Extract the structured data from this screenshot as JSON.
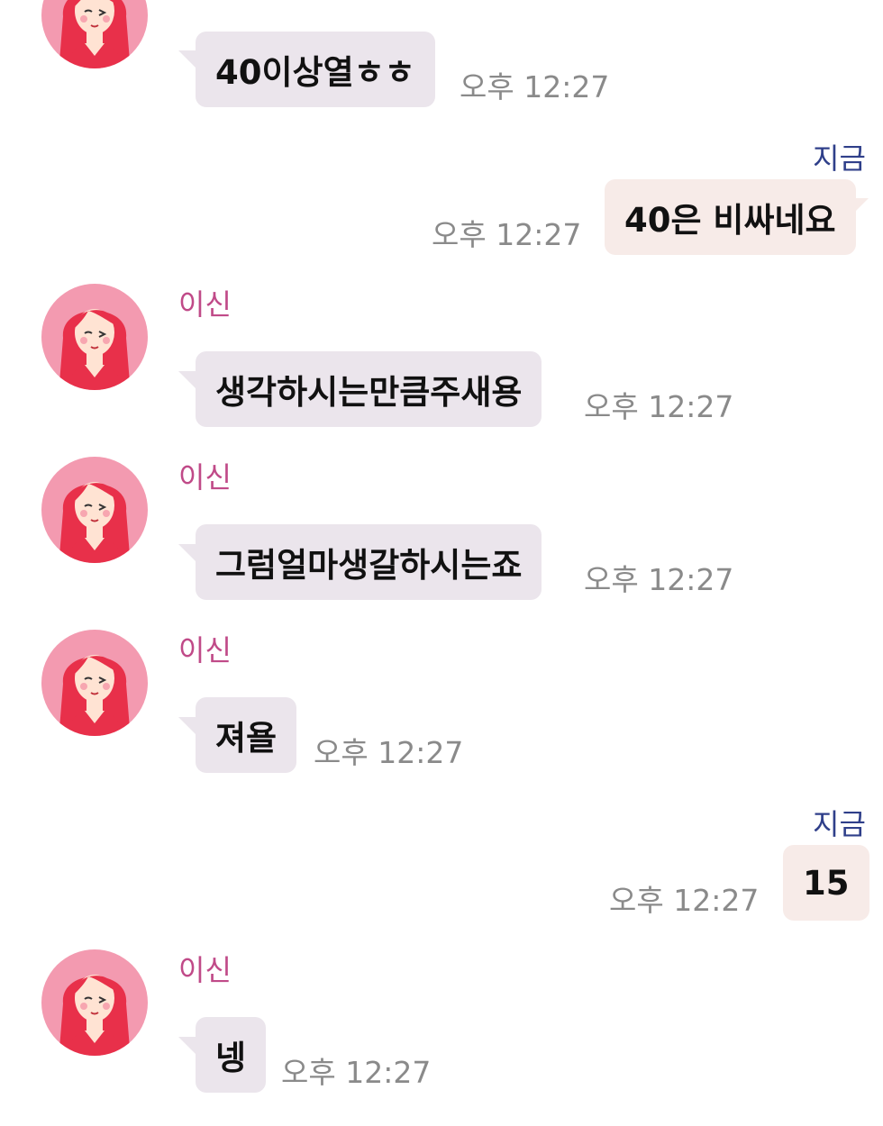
{
  "messages": [
    {
      "direction": "incoming",
      "sender": "",
      "text": "40이상열ㅎㅎ",
      "time": "오후 12:27"
    },
    {
      "direction": "outgoing",
      "status": "지금",
      "text": "40은 비싸네요",
      "time": "오후 12:27"
    },
    {
      "direction": "incoming",
      "sender": "이신",
      "text": "생각하시는만큼주새용",
      "time": "오후 12:27"
    },
    {
      "direction": "incoming",
      "sender": "이신",
      "text": "그럼얼마생갈하시는죠",
      "time": "오후 12:27"
    },
    {
      "direction": "incoming",
      "sender": "이신",
      "text": "져욜",
      "time": "오후 12:27"
    },
    {
      "direction": "outgoing",
      "status": "지금",
      "text": "15",
      "time": "오후 12:27"
    },
    {
      "direction": "incoming",
      "sender": "이신",
      "text": "넹",
      "time": "오후 12:27"
    }
  ],
  "colors": {
    "incoming_bubble": "#ebe5ec",
    "outgoing_bubble": "#f7ebe8",
    "sender_name": "#c04a88",
    "read_status": "#2f3f8a",
    "timestamp": "#8a8a8a",
    "avatar_bg": "#f39ab0"
  },
  "icons": {
    "avatar": "girl-avatar-icon"
  }
}
